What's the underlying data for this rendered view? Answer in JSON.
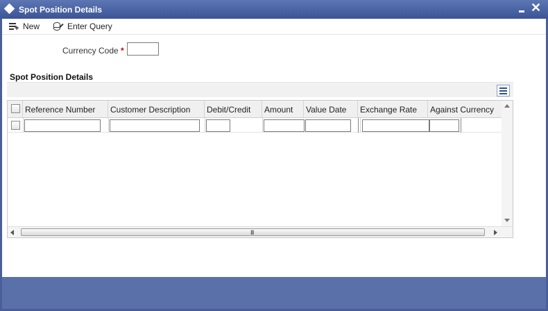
{
  "window": {
    "title": "Spot Position Details",
    "icons": {
      "logo": "diamond-logo-icon",
      "minimize": "minimize-icon",
      "close": "close-icon"
    },
    "close_glyph": "✕"
  },
  "toolbar": {
    "new_label": "New",
    "enter_query_label": "Enter Query"
  },
  "form": {
    "currency_code_label": "Currency Code",
    "required_marker": "*",
    "currency_code_value": ""
  },
  "grid": {
    "section_title": "Spot Position Details",
    "columns": [
      "Reference Number",
      "Customer Description",
      "Debit/Credit",
      "Amount",
      "Value Date",
      "Exchange Rate",
      "Against Currency"
    ],
    "rows": [
      {
        "selected": false,
        "cells": [
          "",
          "",
          "",
          "",
          "",
          "",
          ""
        ]
      }
    ],
    "scroll_grip": "III"
  },
  "colors": {
    "titlebar": "#3b5494",
    "footer": "#5a70a8",
    "required": "#cc0000"
  }
}
